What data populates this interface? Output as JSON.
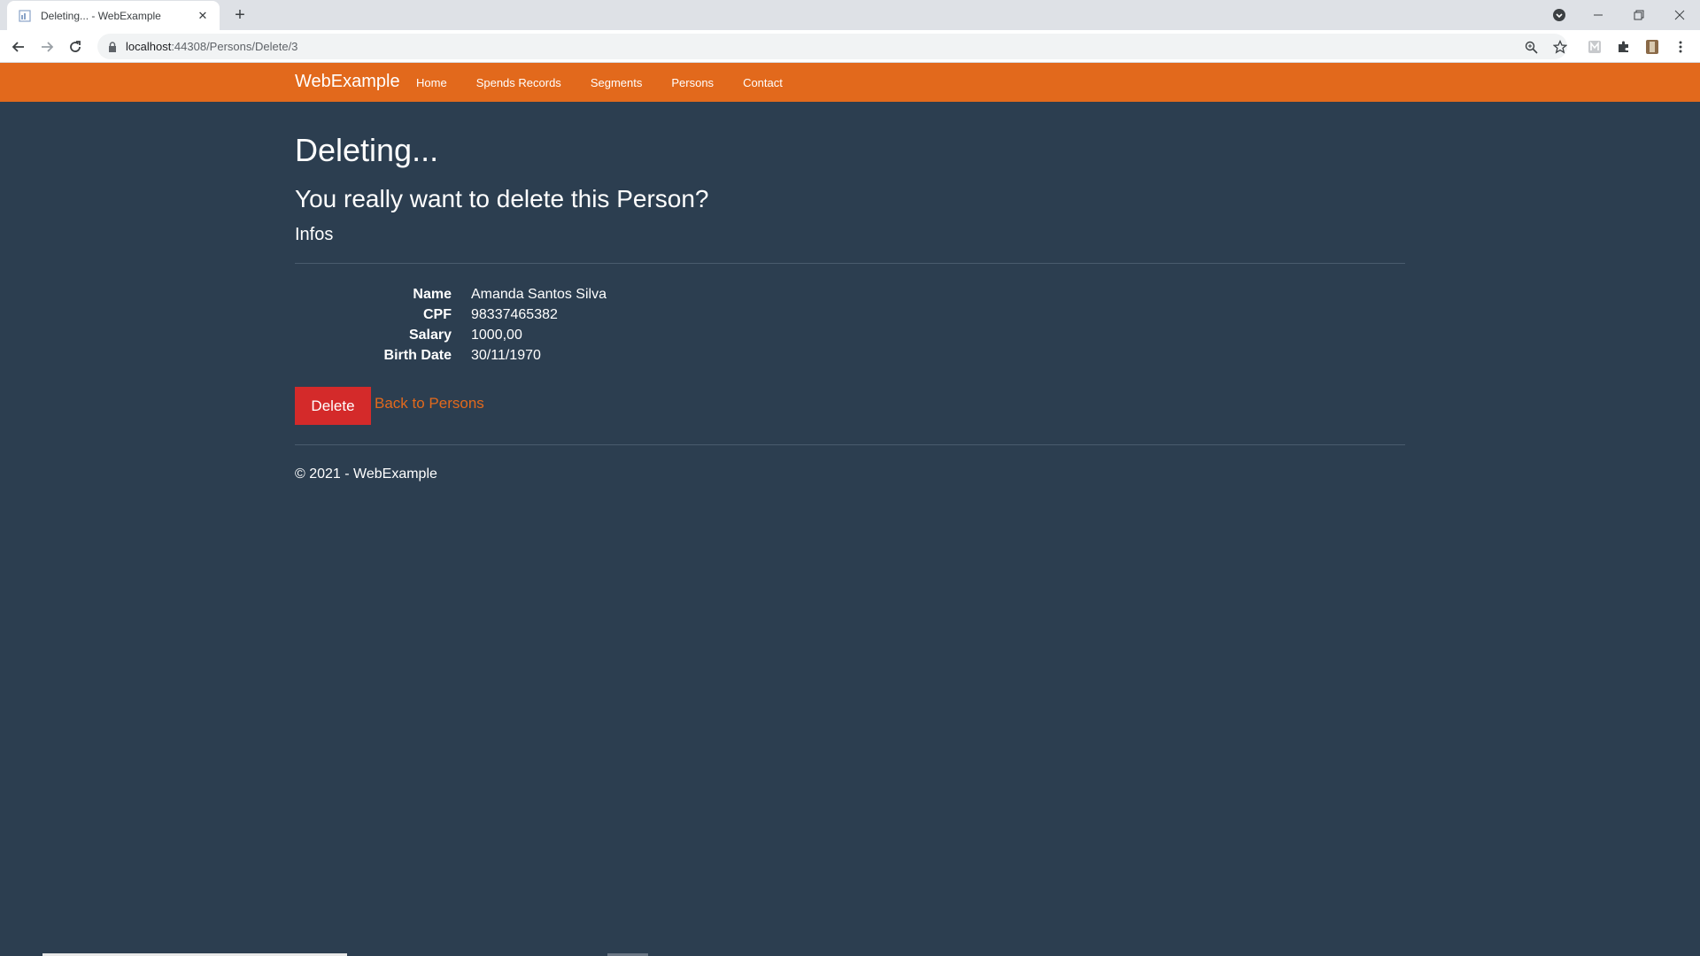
{
  "browser": {
    "tab_title": "Deleting... - WebExample",
    "url_host": "localhost",
    "url_path": ":44308/Persons/Delete/3"
  },
  "navbar": {
    "brand": "WebExample",
    "links": [
      "Home",
      "Spends Records",
      "Segments",
      "Persons",
      "Contact"
    ]
  },
  "page": {
    "title": "Deleting...",
    "question": "You really want to delete this Person?",
    "section": "Infos",
    "details": [
      {
        "label": "Name",
        "value": "Amanda Santos Silva"
      },
      {
        "label": "CPF",
        "value": "98337465382"
      },
      {
        "label": "Salary",
        "value": "1000,00"
      },
      {
        "label": "Birth Date",
        "value": "30/11/1970"
      }
    ],
    "delete_label": "Delete",
    "back_label": "Back to Persons"
  },
  "footer": {
    "text": "© 2021 - WebExample"
  },
  "colors": {
    "navbar": "#e2691c",
    "background": "#2c3e50",
    "danger": "#d42a2a"
  }
}
